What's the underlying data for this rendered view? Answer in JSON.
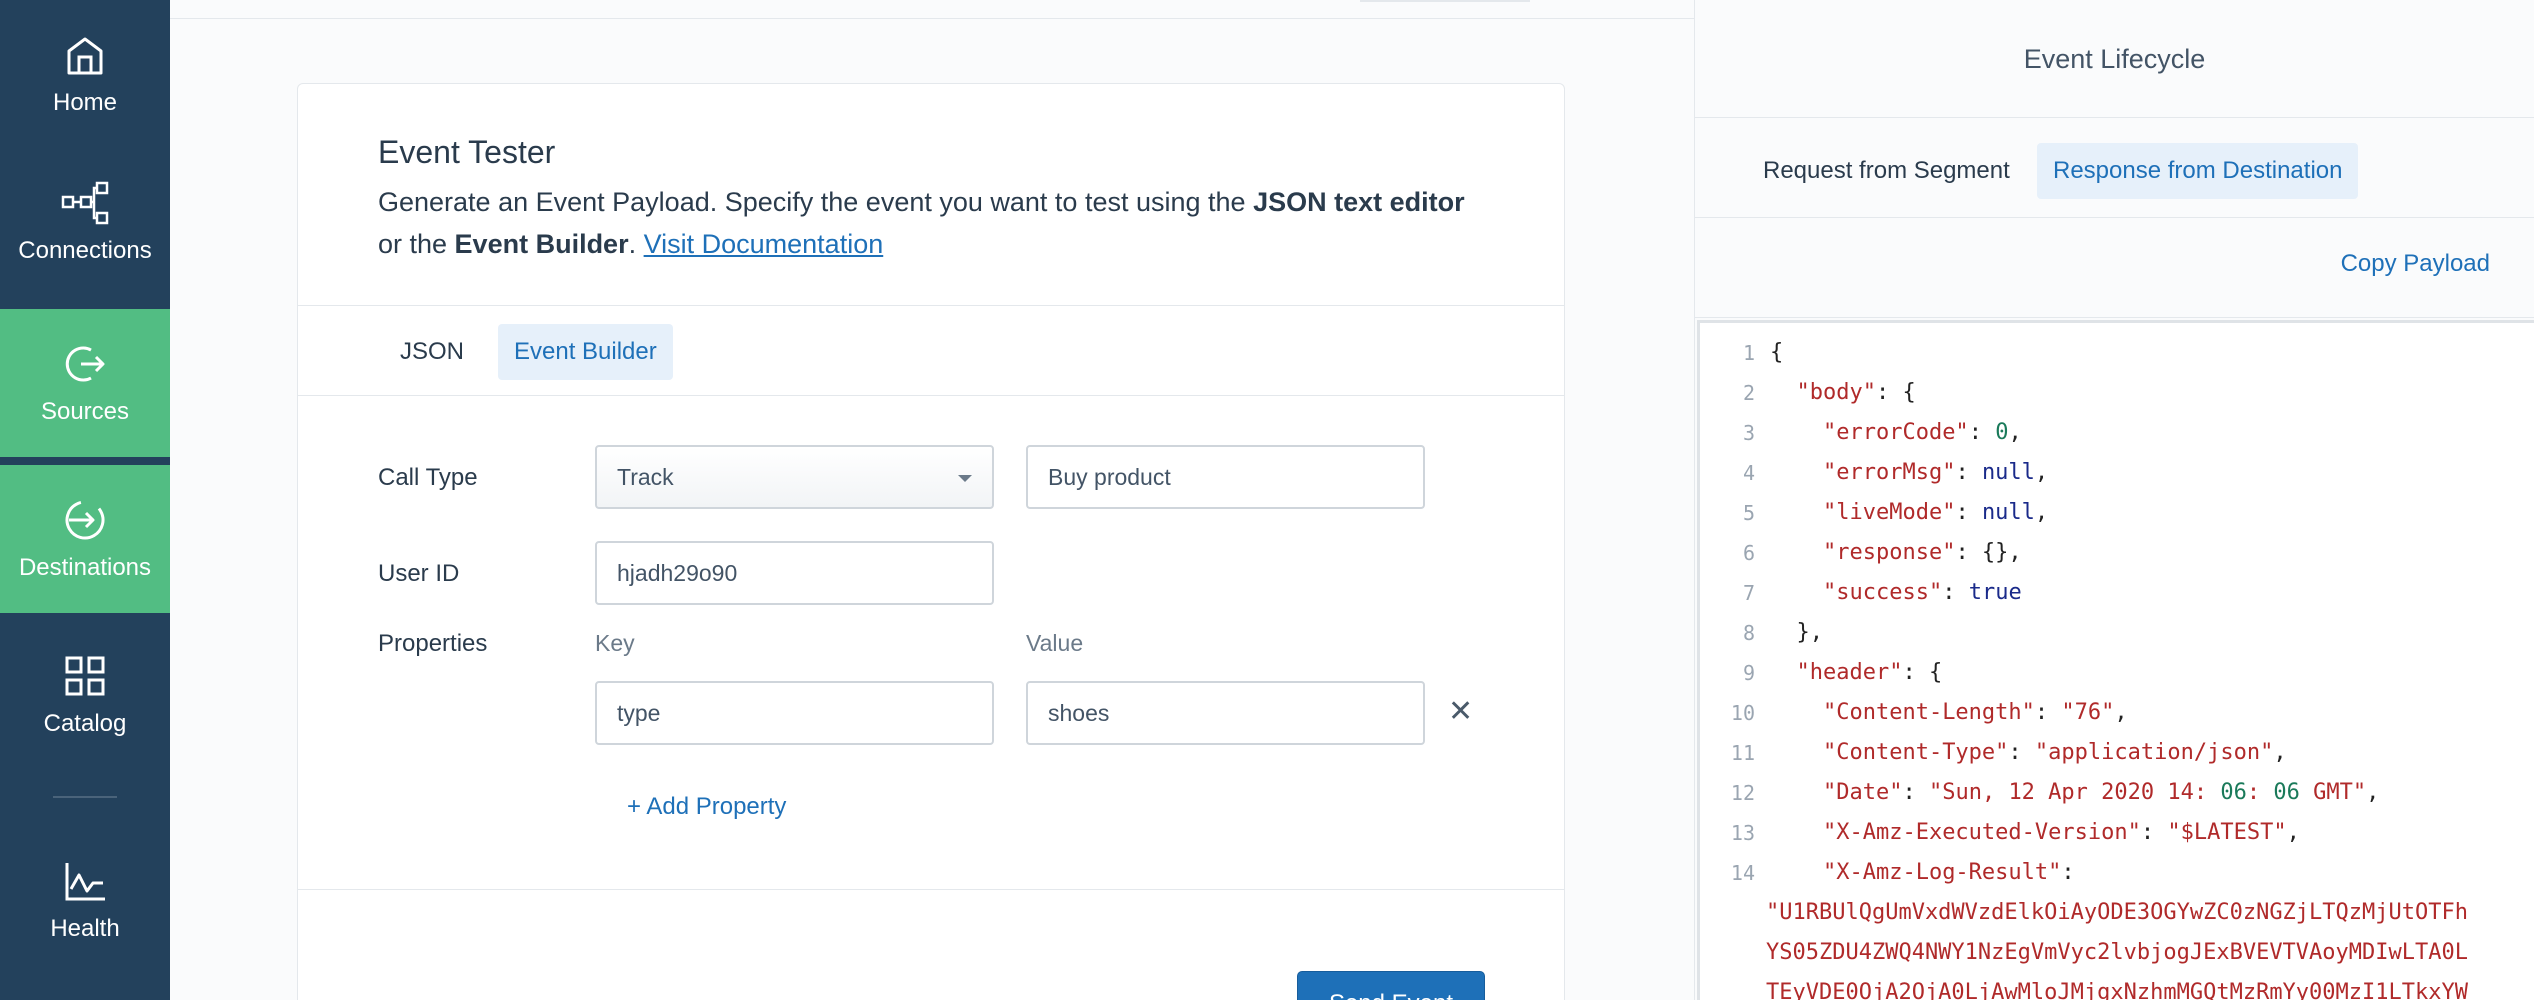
{
  "sidebar": {
    "items": [
      {
        "label": "Home",
        "icon": "home-icon"
      },
      {
        "label": "Connections",
        "icon": "connections-icon"
      },
      {
        "label": "Sources",
        "icon": "sources-icon"
      },
      {
        "label": "Destinations",
        "icon": "destinations-icon"
      },
      {
        "label": "Catalog",
        "icon": "catalog-icon"
      },
      {
        "label": "Health",
        "icon": "health-icon"
      }
    ]
  },
  "card": {
    "title": "Event Tester",
    "desc_part1": "Generate an Event Payload. Specify the event you want to test using the ",
    "desc_bold1": "JSON text editor",
    "desc_part2": " or the ",
    "desc_bold2": "Event Builder",
    "desc_part3": ". ",
    "doc_link": "Visit Documentation",
    "tabs": [
      "JSON",
      "Event Builder"
    ],
    "call_type_label": "Call Type",
    "call_type_value": "Track",
    "event_name_value": "Buy product",
    "user_id_label": "User ID",
    "user_id_value": "hjadh29o90",
    "properties_label": "Properties",
    "key_label": "Key",
    "value_label": "Value",
    "prop_key": "type",
    "prop_value": "shoes",
    "remove_symbol": "✕",
    "add_property": "+ Add Property",
    "send_button": "Send Event"
  },
  "panel": {
    "title": "Event Lifecycle",
    "tabs": [
      "Request from Segment",
      "Response from Destination"
    ],
    "copy_button": "Copy Payload",
    "code_lines": [
      {
        "n": "1",
        "text": "{"
      },
      {
        "n": "2",
        "text": "  \"body\": {"
      },
      {
        "n": "3",
        "text": "    \"errorCode\": 0,"
      },
      {
        "n": "4",
        "text": "    \"errorMsg\": null,"
      },
      {
        "n": "5",
        "text": "    \"liveMode\": null,"
      },
      {
        "n": "6",
        "text": "    \"response\": {},"
      },
      {
        "n": "7",
        "text": "    \"success\": true"
      },
      {
        "n": "8",
        "text": "  },"
      },
      {
        "n": "9",
        "text": "  \"header\": {"
      },
      {
        "n": "10",
        "text": "    \"Content-Length\": \"76\","
      },
      {
        "n": "11",
        "text": "    \"Content-Type\": \"application/json\","
      },
      {
        "n": "12",
        "text": "    \"Date\": \"Sun, 12 Apr 2020 14:06:06 GMT\","
      },
      {
        "n": "13",
        "text": "    \"X-Amz-Executed-Version\": \"$LATEST\","
      },
      {
        "n": "14",
        "text": "    \"X-Amz-Log-Result\":"
      }
    ],
    "wrap_lines": [
      "\"U1RBUlQgUmVxdWVzdElkOiAyODE3OGYwZC0zNGZjLTQzMjUtOTFh",
      "YS05ZDU4ZWQ4NWY1NzEgVmVyc2lvbjogJExBVEVTVAoyMDIwLTA0L",
      "TEyVDE0OjA2OjA0LjAwMloJMjgxNzhmMGQtMzRmYy00MzI1LTkxYW"
    ]
  }
}
